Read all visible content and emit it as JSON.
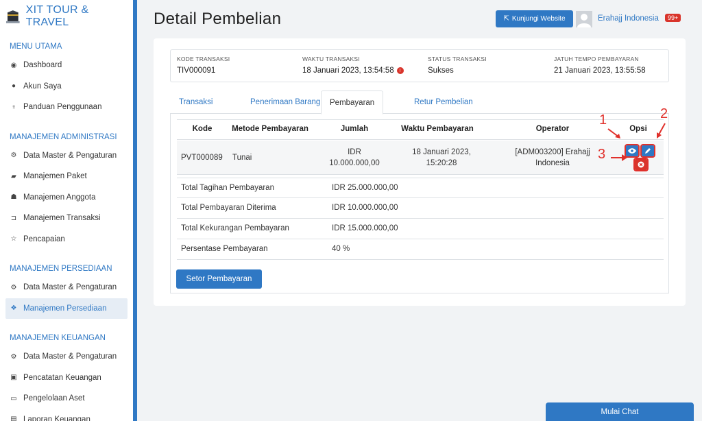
{
  "brand": {
    "name": "XIT TOUR & TRAVEL"
  },
  "sidebar": {
    "sections": [
      {
        "title": "MENU UTAMA",
        "items": [
          {
            "label": "Dashboard",
            "icon": "dashboard-icon"
          },
          {
            "label": "Akun Saya",
            "icon": "user-icon"
          },
          {
            "label": "Panduan Penggunaan",
            "icon": "lightbulb-icon"
          }
        ]
      },
      {
        "title": "MANAJEMEN ADMINISTRASI",
        "items": [
          {
            "label": "Data Master & Pengaturan",
            "icon": "cogs-icon"
          },
          {
            "label": "Manajemen Paket",
            "icon": "book-icon"
          },
          {
            "label": "Manajemen Anggota",
            "icon": "users-icon"
          },
          {
            "label": "Manajemen Transaksi",
            "icon": "cart-icon"
          },
          {
            "label": "Pencapaian",
            "icon": "star-icon"
          }
        ]
      },
      {
        "title": "MANAJEMEN PERSEDIAAN",
        "items": [
          {
            "label": "Data Master & Pengaturan",
            "icon": "cogs-icon"
          },
          {
            "label": "Manajemen Persediaan",
            "icon": "cubes-icon",
            "active": true
          }
        ]
      },
      {
        "title": "MANAJEMEN KEUANGAN",
        "items": [
          {
            "label": "Data Master & Pengaturan",
            "icon": "cogs-icon"
          },
          {
            "label": "Pencatatan Keuangan",
            "icon": "money-icon"
          },
          {
            "label": "Pengelolaan Aset",
            "icon": "drive-icon"
          },
          {
            "label": "Laporan Keuangan",
            "icon": "report-icon"
          }
        ]
      }
    ]
  },
  "header": {
    "title": "Detail Pembelian",
    "visit_button": "Kunjungi Website",
    "user_name": "Erahajj Indonesia",
    "notif_count": "99+"
  },
  "info": {
    "kode_label": "KODE TRANSAKSI",
    "kode_value": "TIV000091",
    "waktu_label": "WAKTU TRANSAKSI",
    "waktu_value": "18 Januari 2023, 13:54:58",
    "status_label": "STATUS TRANSAKSI",
    "status_value": "Sukses",
    "jatuh_label": "JATUH TEMPO PEMBAYARAN",
    "jatuh_value": "21 Januari 2023, 13:55:58"
  },
  "tabs": [
    "Transaksi",
    "Penerimaan Barang",
    "Pembayaran",
    "Retur Pembelian"
  ],
  "active_tab": "Pembayaran",
  "table": {
    "headers": [
      "Kode",
      "Metode Pembayaran",
      "Jumlah",
      "Waktu Pembayaran",
      "Operator",
      "Opsi"
    ],
    "rows": [
      {
        "kode": "PVT000089",
        "metode": "Tunai",
        "jumlah_1": "IDR",
        "jumlah_2": "10.000.000,00",
        "waktu_1": "18 Januari 2023,",
        "waktu_2": "15:20:28",
        "operator_1": "[ADM003200] Erahajj",
        "operator_2": "Indonesia"
      }
    ]
  },
  "annotations": [
    "1",
    "2",
    "3"
  ],
  "summary": [
    {
      "label": "Total Tagihan Pembayaran",
      "value": "IDR 25.000.000,00"
    },
    {
      "label": "Total Pembayaran Diterima",
      "value": "IDR 10.000.000,00"
    },
    {
      "label": "Total Kekurangan Pembayaran",
      "value": "IDR 15.000.000,00"
    },
    {
      "label": "Persentase Pembayaran",
      "value": "40 %"
    }
  ],
  "setor_button": "Setor Pembayaran",
  "chat_button": "Mulai Chat",
  "colors": {
    "primary": "#2f78c4",
    "danger": "#d9342b",
    "annotation": "#e0302b"
  }
}
